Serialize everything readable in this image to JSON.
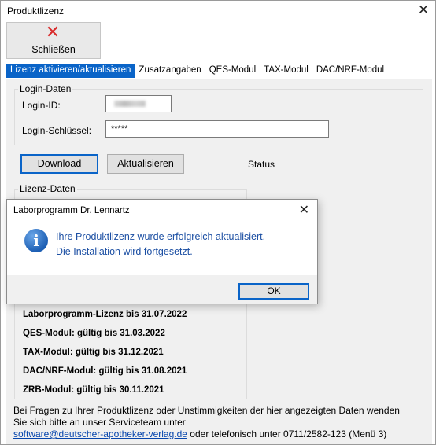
{
  "window": {
    "title": "Produktlizenz",
    "close_glyph": "✕"
  },
  "toolbar": {
    "close_label": "Schließen"
  },
  "tabs": [
    {
      "label": "Lizenz aktivieren/aktualisieren",
      "active": true
    },
    {
      "label": "Zusatzangaben"
    },
    {
      "label": "QES-Modul"
    },
    {
      "label": "TAX-Modul"
    },
    {
      "label": "DAC/NRF-Modul"
    }
  ],
  "login": {
    "group_caption": "Login-Daten",
    "id_label": "Login-ID:",
    "key_label": "Login-Schlüssel:",
    "key_value": "*****"
  },
  "actions": {
    "download_label": "Download",
    "update_label": "Aktualisieren",
    "status_label": "Status"
  },
  "license": {
    "group_caption": "Lizenz-Daten",
    "lines": [
      "Laborprogramm-Lizenz bis 31.07.2022",
      "QES-Modul: gültig bis 31.03.2022",
      "TAX-Modul: gültig bis 31.12.2021",
      "DAC/NRF-Modul: gültig bis 31.08.2021",
      "ZRB-Modul: gültig bis 30.11.2021"
    ]
  },
  "footer": {
    "line1": "Bei Fragen zu Ihrer Produktlizenz oder Unstimmigkeiten der hier angezeigten Daten wenden",
    "line2": "Sie sich bitte an unser Serviceteam unter",
    "email": "software@deutscher-apotheker-verlag.de",
    "line3_rest": " oder telefonisch unter 0711/2582-123 (Menü 3)"
  },
  "dialog": {
    "title": "Laborprogramm Dr. Lennartz",
    "close_glyph": "✕",
    "message_line1": "Ihre Produktlizenz wurde erfolgreich aktualisiert.",
    "message_line2": "Die Installation wird fortgesetzt.",
    "ok_label": "OK",
    "icon_glyph": "i"
  },
  "colors": {
    "accent": "#0a64c8",
    "message_text": "#1c4fa3",
    "close_icon_red": "#d92b2b"
  }
}
